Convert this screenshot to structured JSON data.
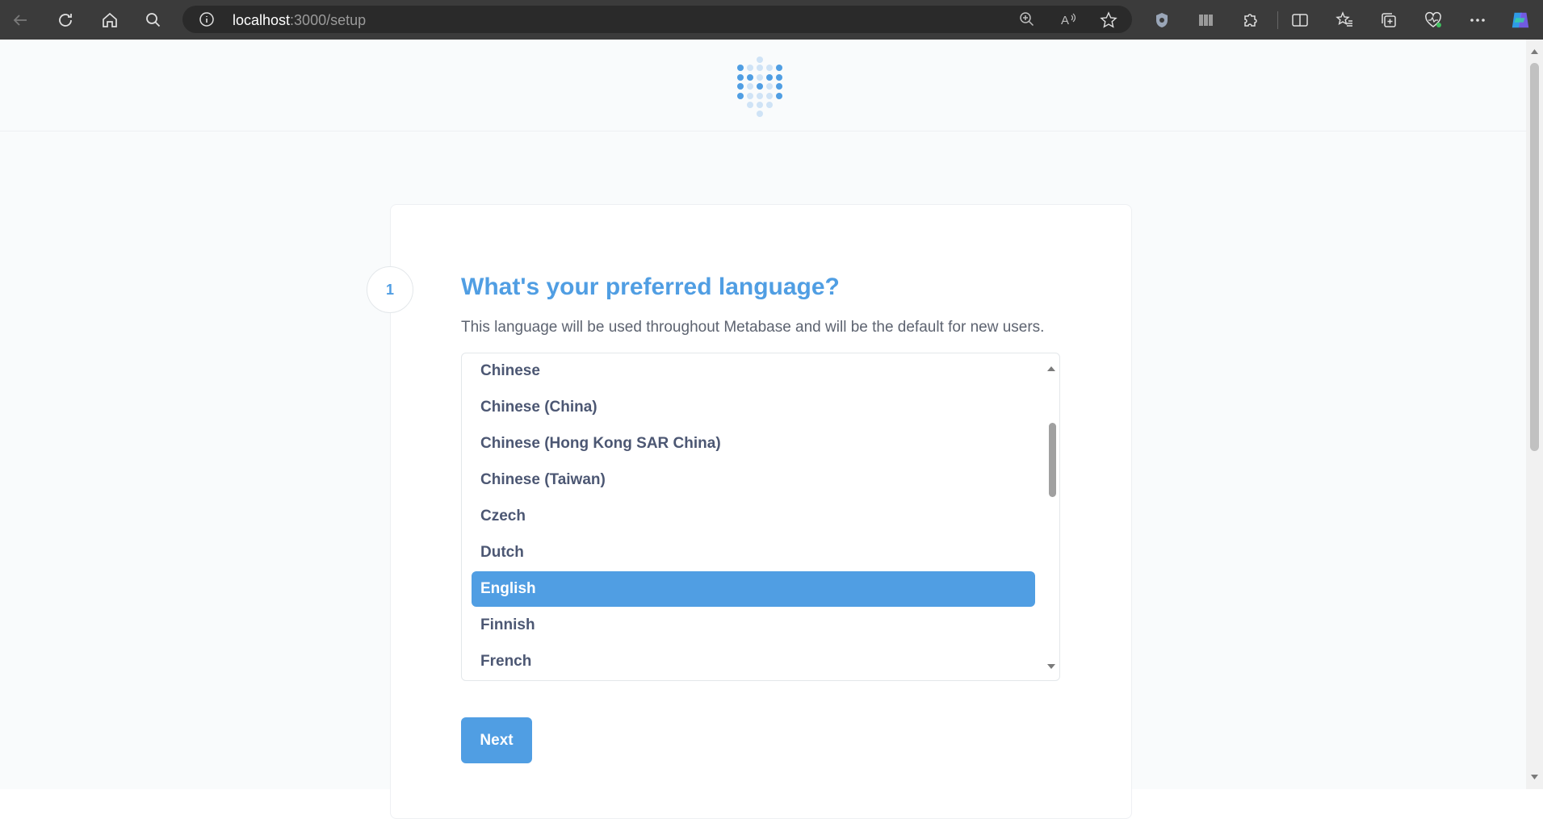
{
  "browser": {
    "url_host": "localhost",
    "url_path": ":3000/setup",
    "icons": [
      "back-icon",
      "refresh-icon",
      "home-icon",
      "search-icon",
      "site-info-icon",
      "zoom-icon",
      "read-aloud-icon",
      "favorite-star-icon",
      "shield-extension-icon",
      "reading-view-icon",
      "extensions-icon",
      "split-screen-icon",
      "favorites-icon",
      "collections-icon",
      "browser-essentials-icon",
      "more-icon",
      "copilot-icon"
    ]
  },
  "setup": {
    "step_number": "1",
    "title": "What's your preferred language?",
    "description": "This language will be used throughout Metabase and will be the default for new users.",
    "languages": [
      {
        "label": "Chinese",
        "selected": false
      },
      {
        "label": "Chinese (China)",
        "selected": false
      },
      {
        "label": "Chinese (Hong Kong SAR China)",
        "selected": false
      },
      {
        "label": "Chinese (Taiwan)",
        "selected": false
      },
      {
        "label": "Czech",
        "selected": false
      },
      {
        "label": "Dutch",
        "selected": false
      },
      {
        "label": "English",
        "selected": true
      },
      {
        "label": "Finnish",
        "selected": false
      },
      {
        "label": "French",
        "selected": false
      }
    ],
    "selected_language": "English",
    "next_label": "Next"
  },
  "colors": {
    "brand": "#509ee3",
    "text_dark": "#4c5773",
    "text_medium": "#5d6370",
    "chrome_bg": "#3b3b3b"
  }
}
